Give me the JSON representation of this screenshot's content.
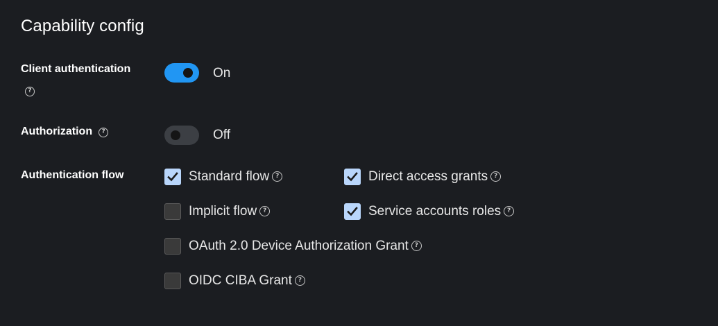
{
  "section": {
    "title": "Capability config"
  },
  "client_authentication": {
    "label": "Client authentication",
    "state_text": "On",
    "enabled": true
  },
  "authorization": {
    "label": "Authorization",
    "state_text": "Off",
    "enabled": false
  },
  "authentication_flow": {
    "label": "Authentication flow",
    "options": [
      {
        "label": "Standard flow",
        "checked": true
      },
      {
        "label": "Direct access grants",
        "checked": true
      },
      {
        "label": "Implicit flow",
        "checked": false
      },
      {
        "label": "Service accounts roles",
        "checked": true
      },
      {
        "label": "OAuth 2.0 Device Authorization Grant",
        "checked": false
      },
      {
        "label": "OIDC CIBA Grant",
        "checked": false
      }
    ]
  },
  "colors": {
    "background": "#1b1d21",
    "switch_on": "#2196f3",
    "switch_off": "#3c3f44",
    "checkbox_checked": "#b9d6fb"
  }
}
